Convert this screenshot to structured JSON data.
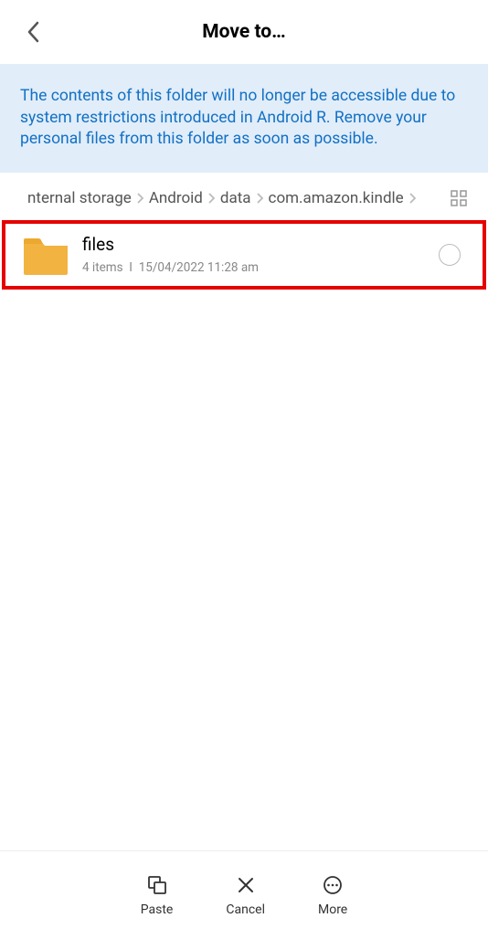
{
  "header": {
    "title": "Move to…"
  },
  "banner": {
    "message": "The contents of this folder will no longer be accessible due to system restrictions introduced in Android R. Remove your personal files from this folder as soon as possible."
  },
  "breadcrumb": {
    "items": [
      "nternal storage",
      "Android",
      "data",
      "com.amazon.kindle"
    ]
  },
  "folders": [
    {
      "name": "files",
      "item_count": "4 items",
      "timestamp": "15/04/2022 11:28 am"
    }
  ],
  "toolbar": {
    "paste": "Paste",
    "cancel": "Cancel",
    "more": "More"
  },
  "colors": {
    "banner_bg": "#e2edfa",
    "banner_text": "#1271c4",
    "highlight_border": "#e60000",
    "folder_fill": "#f3b341"
  }
}
